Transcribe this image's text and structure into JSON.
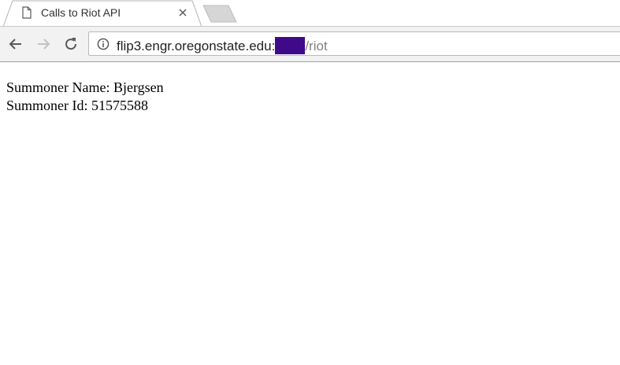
{
  "tab": {
    "title": "Calls to Riot API",
    "favicon": "document-icon",
    "close_icon": "close-icon"
  },
  "toolbar": {
    "back_icon": "back-arrow-icon",
    "forward_icon": "forward-arrow-icon",
    "reload_icon": "reload-icon"
  },
  "omnibox": {
    "info_icon": "info-icon",
    "host": "flip3.engr.oregonstate.edu:",
    "path": "/riot",
    "redaction_color": "#3f0a8a"
  },
  "page": {
    "summoner_name_line": "Summoner Name: Bjergsen",
    "summoner_id_line": "Summoner Id: 51575588"
  }
}
